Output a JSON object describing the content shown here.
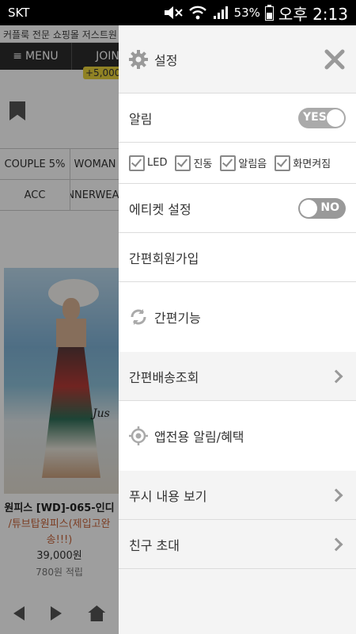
{
  "status_bar": {
    "carrier": "SKT",
    "battery": "53%",
    "time": "오후 2:13"
  },
  "background_page": {
    "banner": "커플룩 전문 쇼핑몰 저스트원",
    "menu_label": "MENU",
    "join_label": "JOIN",
    "join_badge": "+5,000",
    "categories": [
      [
        "COUPLE 5%",
        "WOMAN"
      ],
      [
        "ACC",
        "INNERWEAR"
      ]
    ],
    "photo_text": "Jus",
    "product": {
      "name": "원피스 [WD]-065-인디",
      "subtitle": "/튜브탑원피스(제입고완",
      "subtitle2": "송!!!)",
      "price": "39,000원",
      "points": "780원 적립"
    }
  },
  "panel": {
    "header": {
      "title": "설정",
      "icons": {
        "settings": "gear-icon",
        "close": "close-icon"
      }
    },
    "notification": {
      "label": "알림",
      "toggle": "YES"
    },
    "options": [
      {
        "label": "LED",
        "checked": true
      },
      {
        "label": "진동",
        "checked": true
      },
      {
        "label": "알림음",
        "checked": true
      },
      {
        "label": "화면켜짐",
        "checked": true
      }
    ],
    "etiquette": {
      "label": "에티켓 설정",
      "toggle": "NO"
    },
    "signup": {
      "label": "간편회원가입"
    },
    "easy_function": {
      "label": "간편기능",
      "icon": "sync-icon"
    },
    "delivery": {
      "label": "간편배송조회"
    },
    "app_alert": {
      "label": "앱전용 알림/혜택",
      "icon": "target-icon"
    },
    "push": {
      "label": "푸시 내용 보기"
    },
    "invite": {
      "label": "친구 초대"
    }
  },
  "colors": {
    "panel_bg": "#f4f4f4",
    "dim_overlay": "rgba(0,0,0,0.38)",
    "toggle": "#aaaaaa"
  }
}
